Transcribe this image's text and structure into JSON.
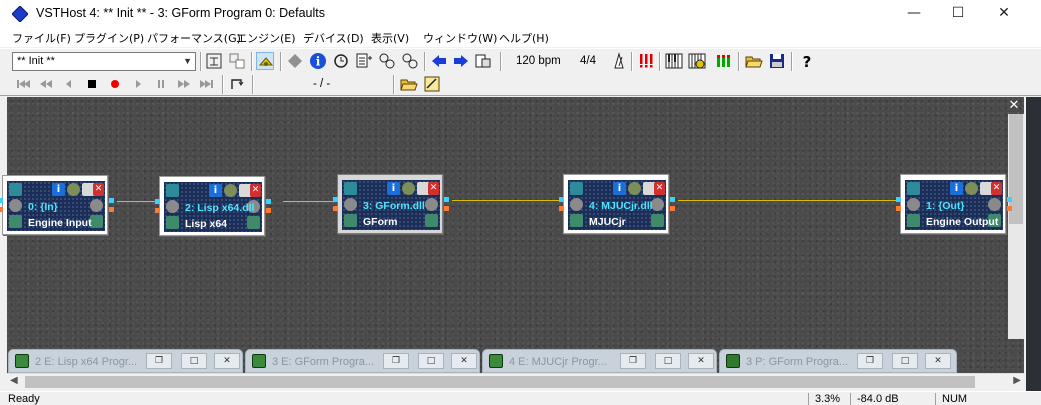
{
  "window": {
    "title": "VSTHost 4: ** Init ** - 3: GForm Program 0: Defaults",
    "minimize": "—",
    "maximize": "☐",
    "close": "✕"
  },
  "menu": [
    "ファイル(F)",
    "プラグイン(P)",
    "パフォーマンス(G)",
    "エンジン(E)",
    "デバイス(D)",
    "表示(V)",
    "ウィンドウ(W)",
    "ヘルプ(H)"
  ],
  "toolbar": {
    "performance_combo": "** Init **",
    "tempo": "120 bpm",
    "time_signature": "4/4",
    "position": "- / -"
  },
  "modules": [
    {
      "title": "0: {In}",
      "label": "Engine Input"
    },
    {
      "title": "2: Lisp x64.dll",
      "label": "Lisp x64"
    },
    {
      "title": "3: GForm.dll",
      "label": "GForm"
    },
    {
      "title": "4: MJUCjr.dll",
      "label": "MJUCjr"
    },
    {
      "title": "1: {Out}",
      "label": "Engine Output"
    }
  ],
  "editor_windows": [
    {
      "title": "2 E: Lisp x64 Progr..."
    },
    {
      "title": "3 E: GForm Progra..."
    },
    {
      "title": "4 E: MJUCjr Progr..."
    },
    {
      "title": "3 P: GForm Progra..."
    }
  ],
  "status": {
    "ready": "Ready",
    "cpu": "3.3%",
    "level": "-84.0 dB",
    "numlock": "NUM"
  },
  "colors": {
    "module_panel": "#1a2e5a",
    "module_title": "#4fe6ff",
    "wire": "#d8c000",
    "workspace": "#4a4a4a"
  }
}
